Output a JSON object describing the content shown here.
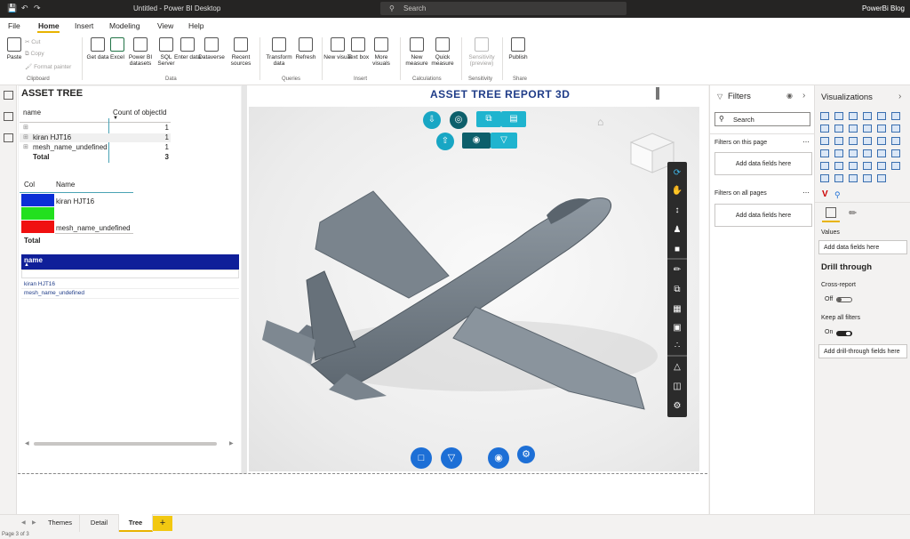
{
  "titlebar": {
    "title": "Untitled - Power BI Desktop",
    "search_placeholder": "Search",
    "user": "PowerBi Blog"
  },
  "menu": [
    "File",
    "Home",
    "Insert",
    "Modeling",
    "View",
    "Help"
  ],
  "ribbon": {
    "clipboard": {
      "paste": "Paste",
      "cut": "Cut",
      "copy": "Copy",
      "format_painter": "Format painter",
      "group": "Clipboard"
    },
    "data_buttons": [
      "Get data",
      "Excel",
      "Power BI datasets",
      "SQL Server",
      "Enter data",
      "Dataverse",
      "Recent sources"
    ],
    "data_group": "Data",
    "queries_buttons": [
      "Transform data",
      "Refresh"
    ],
    "queries_group": "Queries",
    "insert_buttons": [
      "New visual",
      "Text box",
      "More visuals"
    ],
    "insert_group": "Insert",
    "calc_buttons": [
      "New measure",
      "Quick measure"
    ],
    "calc_group": "Calculations",
    "sensitivity": {
      "label": "Sensitivity (preview)",
      "group": "Sensitivity"
    },
    "share": {
      "label": "Publish",
      "group": "Share"
    }
  },
  "tree": {
    "title": "ASSET TREE",
    "table1": {
      "col1": "name",
      "col2": "Count of objectId",
      "rows": [
        {
          "name": "",
          "count": "1"
        },
        {
          "name": "kiran HJT16",
          "count": "1"
        },
        {
          "name": "mesh_name_undefined",
          "count": "1"
        }
      ],
      "total_label": "Total",
      "total_value": "3"
    },
    "table2": {
      "col1": "Col",
      "col2": "Name",
      "rows": [
        {
          "color": "#0b2fd6",
          "name": "kiran HJT16"
        },
        {
          "color": "#22e01e",
          "name": ""
        },
        {
          "color": "#f01010",
          "name": "mesh_name_undefined"
        }
      ],
      "total_label": "Total"
    },
    "slicer": {
      "header": "name",
      "items": [
        "kiran HJT16",
        "mesh_name_undefined"
      ]
    }
  },
  "report": {
    "title": "ASSET TREE REPORT 3D"
  },
  "filters": {
    "title": "Filters",
    "search_placeholder": "Search",
    "on_page": "Filters on this page",
    "on_all": "Filters on all pages",
    "add_fields": "Add data fields here"
  },
  "viz": {
    "title": "Visualizations",
    "values_label": "Values",
    "add_fields": "Add data fields here",
    "drill_title": "Drill through",
    "cross_report": "Cross-report",
    "off": "Off",
    "keep_filters": "Keep all filters",
    "on": "On",
    "add_drill": "Add drill-through fields here"
  },
  "tabs": [
    "Themes",
    "Detail",
    "Tree"
  ],
  "status": "Page 3 of 3"
}
